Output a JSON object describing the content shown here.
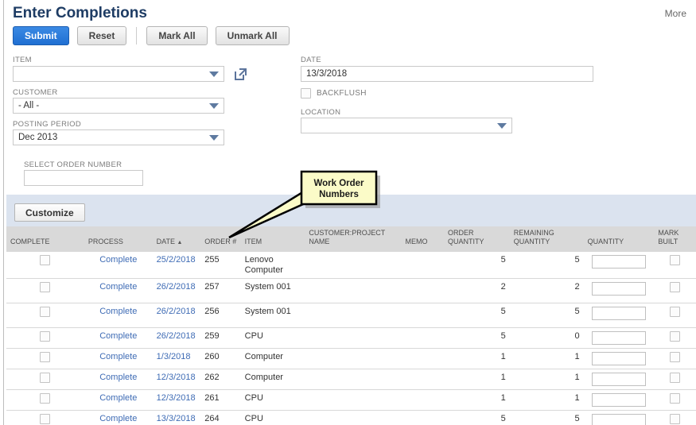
{
  "page": {
    "title": "Enter Completions",
    "more_label": "More"
  },
  "toolbar": {
    "submit_label": "Submit",
    "reset_label": "Reset",
    "mark_all_label": "Mark All",
    "unmark_all_label": "Unmark All"
  },
  "filters": {
    "item": {
      "label": "ITEM",
      "value": ""
    },
    "customer": {
      "label": "CUSTOMER",
      "value": "- All -"
    },
    "posting_period": {
      "label": "POSTING PERIOD",
      "value": "Dec 2013"
    },
    "select_order_number": {
      "label": "SELECT ORDER NUMBER",
      "value": ""
    },
    "date": {
      "label": "DATE",
      "value": "13/3/2018"
    },
    "backflush": {
      "label": "BACKFLUSH",
      "checked": false
    },
    "location": {
      "label": "LOCATION",
      "value": ""
    }
  },
  "callout": {
    "line1": "Work Order",
    "line2": "Numbers"
  },
  "table": {
    "customize_label": "Customize",
    "sort_indicator": "▲",
    "columns": [
      "COMPLETE",
      "PROCESS",
      "DATE",
      "ORDER #",
      "ITEM",
      "CUSTOMER:PROJECT NAME",
      "MEMO",
      "ORDER QUANTITY",
      "REMAINING QUANTITY",
      "QUANTITY",
      "MARK BUILT"
    ],
    "rows": [
      {
        "process": "Complete",
        "date": "25/2/2018",
        "order": "255",
        "item": "Lenovo Computer",
        "customer": "",
        "memo": "",
        "order_qty": "5",
        "remaining_qty": "5",
        "quantity": ""
      },
      {
        "process": "Complete",
        "date": "26/2/2018",
        "order": "257",
        "item": "System 001",
        "customer": "",
        "memo": "",
        "order_qty": "2",
        "remaining_qty": "2",
        "quantity": ""
      },
      {
        "process": "Complete",
        "date": "26/2/2018",
        "order": "256",
        "item": "System 001",
        "customer": "",
        "memo": "",
        "order_qty": "5",
        "remaining_qty": "5",
        "quantity": ""
      },
      {
        "process": "Complete",
        "date": "26/2/2018",
        "order": "259",
        "item": "CPU",
        "customer": "",
        "memo": "",
        "order_qty": "5",
        "remaining_qty": "0",
        "quantity": ""
      },
      {
        "process": "Complete",
        "date": "1/3/2018",
        "order": "260",
        "item": "Computer",
        "customer": "",
        "memo": "",
        "order_qty": "1",
        "remaining_qty": "1",
        "quantity": ""
      },
      {
        "process": "Complete",
        "date": "12/3/2018",
        "order": "262",
        "item": "Computer",
        "customer": "",
        "memo": "",
        "order_qty": "1",
        "remaining_qty": "1",
        "quantity": ""
      },
      {
        "process": "Complete",
        "date": "12/3/2018",
        "order": "261",
        "item": "CPU",
        "customer": "",
        "memo": "",
        "order_qty": "1",
        "remaining_qty": "1",
        "quantity": ""
      },
      {
        "process": "Complete",
        "date": "13/3/2018",
        "order": "264",
        "item": "CPU",
        "customer": "",
        "memo": "",
        "order_qty": "5",
        "remaining_qty": "5",
        "quantity": ""
      }
    ]
  },
  "colors": {
    "title": "#1e3c64",
    "primary_button": "#2478dd",
    "link": "#3f6cb5",
    "panel_background": "#dbe3ef",
    "header_background": "#d9d9d9",
    "callout_fill": "#fbfbc8"
  }
}
